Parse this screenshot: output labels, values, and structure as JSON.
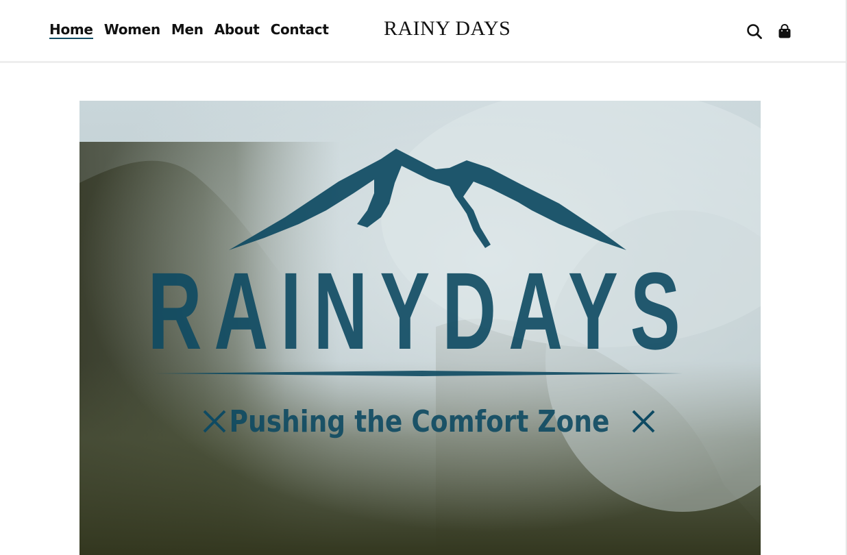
{
  "nav": {
    "items": [
      {
        "label": "Home",
        "active": true
      },
      {
        "label": "Women",
        "active": false
      },
      {
        "label": "Men",
        "active": false
      },
      {
        "label": "About",
        "active": false
      },
      {
        "label": "Contact",
        "active": false
      }
    ]
  },
  "brand": {
    "title": "RAINY DAYS"
  },
  "header_icons": {
    "search": "search-icon",
    "cart": "shopping-bag-icon"
  },
  "hero": {
    "logo_text": "RAINYDAYS",
    "tagline": "Pushing the Comfort Zone",
    "logo_color": "#0e4a62"
  }
}
